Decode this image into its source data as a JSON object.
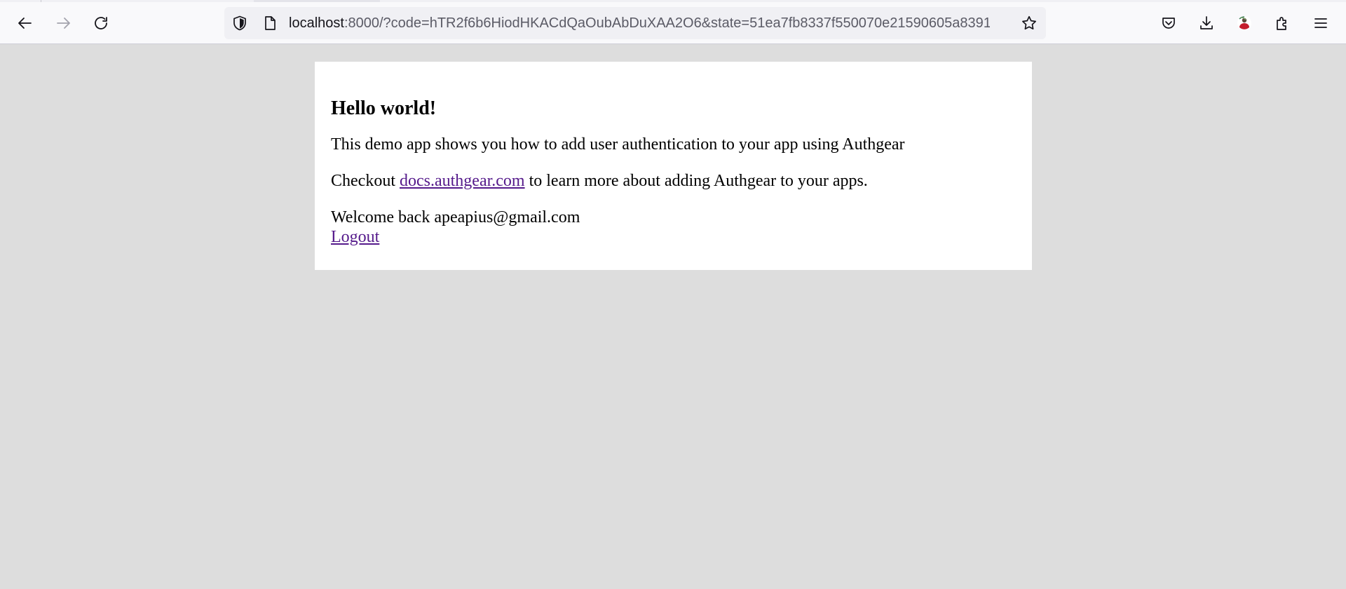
{
  "browser": {
    "url_host": "localhost",
    "url_rest": ":8000/?code=hTR2f6b6HiodHKACdQaOubAbDuXAA2O6&state=51ea7fb8337f550070e21590605a8391",
    "toolbar_icons": [
      "back-icon",
      "forward-icon",
      "reload-icon",
      "shield-icon",
      "page-icon",
      "star-icon",
      "pocket-icon",
      "download-icon",
      "profile-icon",
      "extensions-icon",
      "menu-icon"
    ]
  },
  "page": {
    "heading": "Hello world!",
    "intro": "This demo app shows you how to add user authentication to your app using Authgear",
    "checkout_prefix": "Checkout ",
    "docs_link": "docs.authgear.com",
    "checkout_suffix": " to learn more about adding Authgear to your apps.",
    "welcome": "Welcome back apeapius@gmail.com",
    "logout": "Logout"
  },
  "colors": {
    "page_background": "#dddddd",
    "card_background": "#ffffff",
    "link": "#551a8b"
  }
}
